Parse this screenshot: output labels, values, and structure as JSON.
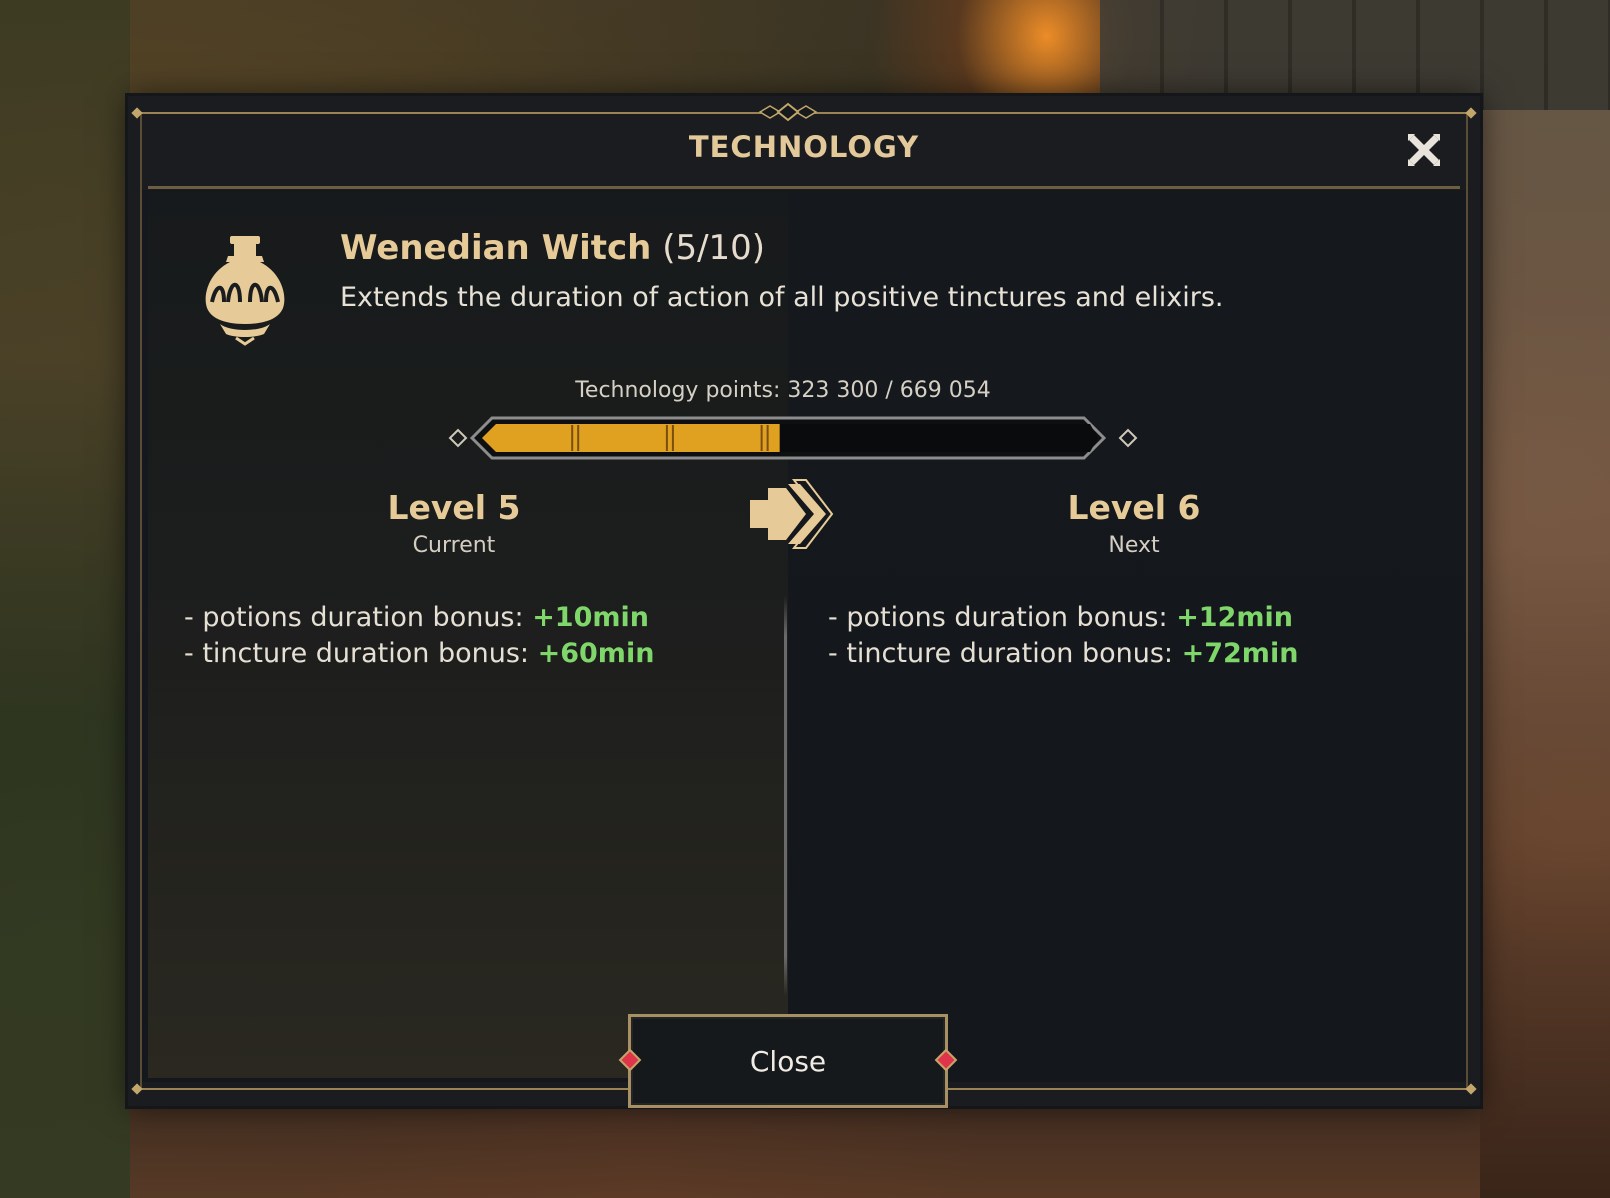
{
  "dialog": {
    "title": "TECHNOLOGY",
    "close_icon": "close-x-icon"
  },
  "technology": {
    "icon": "potion-bottle-icon",
    "name": "Wenedian Witch",
    "level_display": "(5/10)",
    "description": "Extends the duration of action of all positive tinctures and elixirs."
  },
  "progress": {
    "label": "Technology points: 323 300 / 669 054",
    "current": 323300,
    "max": 669054
  },
  "levels": {
    "current": {
      "title": "Level 5",
      "subtitle": "Current",
      "bonuses": [
        {
          "label": "- potions duration bonus: ",
          "value": "+10min"
        },
        {
          "label": "- tincture duration bonus: ",
          "value": "+60min"
        }
      ]
    },
    "next": {
      "title": "Level 6",
      "subtitle": "Next",
      "bonuses": [
        {
          "label": "- potions duration bonus: ",
          "value": "+12min"
        },
        {
          "label": "- tincture duration bonus: ",
          "value": "+72min"
        }
      ]
    },
    "arrow_icon": "double-chevron-right-icon"
  },
  "footer": {
    "close_label": "Close"
  },
  "colors": {
    "gold": "#e6cb98",
    "bonus_green": "#7fd66a",
    "progress_fill": "#e0a020",
    "gem_red": "#e0344a"
  }
}
